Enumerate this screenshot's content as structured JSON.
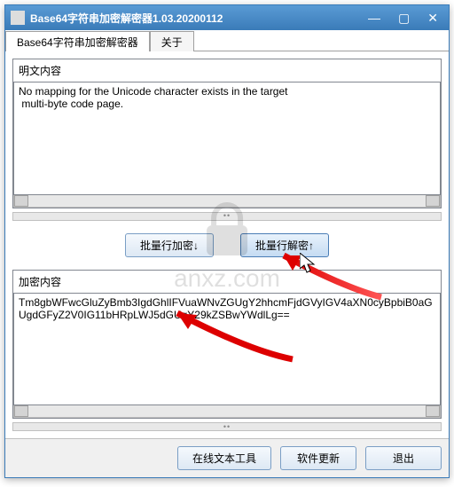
{
  "window": {
    "title": "Base64字符串加密解密器1.03.20200112"
  },
  "tabs": {
    "main": "Base64字符串加密解密器",
    "about": "关于"
  },
  "labels": {
    "plaintext": "明文内容",
    "ciphertext": "加密内容"
  },
  "text": {
    "plaintext": "No mapping for the Unicode character exists in the target\n multi-byte code page.",
    "ciphertext": "Tm8gbWFwcGluZyBmb3IgdGhlIFVuaWNvZGUgY2hhcmFjdGVyIGV4aXN0cyBpbiB0aGUgdGFyZ2V0IG11bHRpLWJ5dGUgY29kZSBwYWdlLg=="
  },
  "buttons": {
    "batch_encrypt": "批量行加密↓",
    "batch_decrypt": "批量行解密↑",
    "online_tool": "在线文本工具",
    "update": "软件更新",
    "exit": "退出"
  },
  "watermark": {
    "text": "anxz.com"
  }
}
